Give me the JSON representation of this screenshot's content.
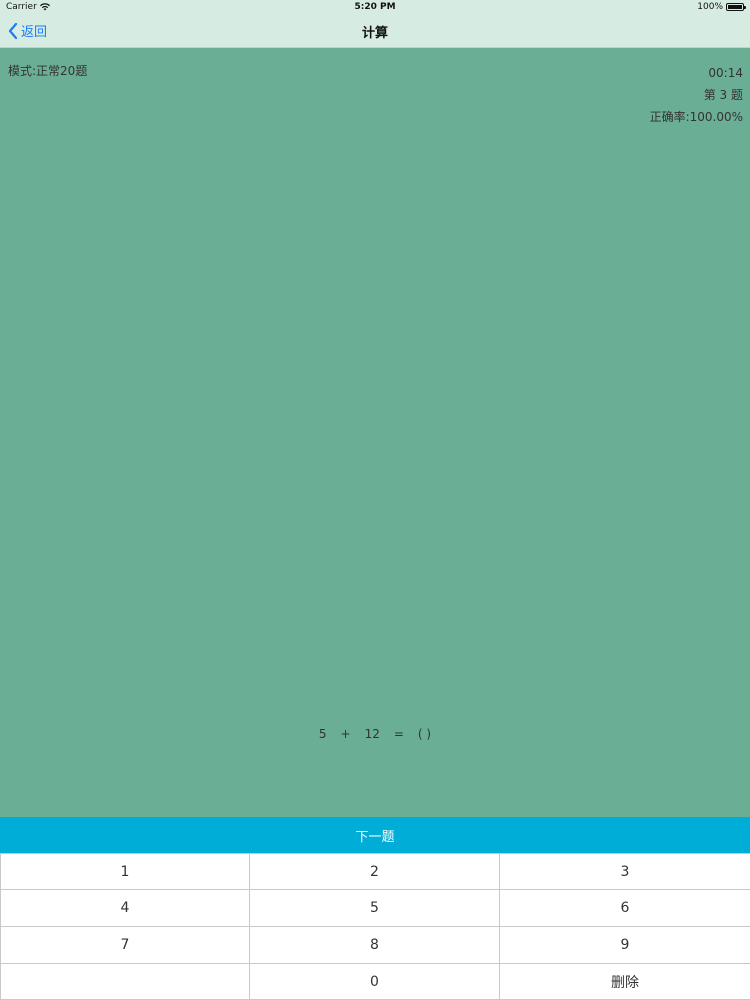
{
  "status_bar": {
    "carrier": "Carrier",
    "time": "5:20 PM",
    "battery": "100%",
    "battery_level": 1.0
  },
  "nav": {
    "back_label": "返回",
    "title": "计算"
  },
  "info": {
    "mode": "模式:正常20题",
    "timer": "00:14",
    "question_number": "第 3 题",
    "accuracy": "正确率:100.00%"
  },
  "equation": {
    "left_operand": "5",
    "operator": "+",
    "right_operand": "12",
    "equals": "=",
    "answer_placeholder": "(   )"
  },
  "next_button": {
    "label": "下一题"
  },
  "keypad": {
    "keys": [
      "1",
      "2",
      "3",
      "4",
      "5",
      "6",
      "7",
      "8",
      "9",
      "",
      "0",
      "删除"
    ]
  },
  "colors": {
    "background": "#6aae95",
    "nav_background": "#d6ece2",
    "accent_blue": "#1a7cf5",
    "next_button": "#00add7"
  },
  "icons": {
    "back": "chevron-left-icon",
    "wifi": "wifi-icon",
    "battery": "battery-icon"
  }
}
